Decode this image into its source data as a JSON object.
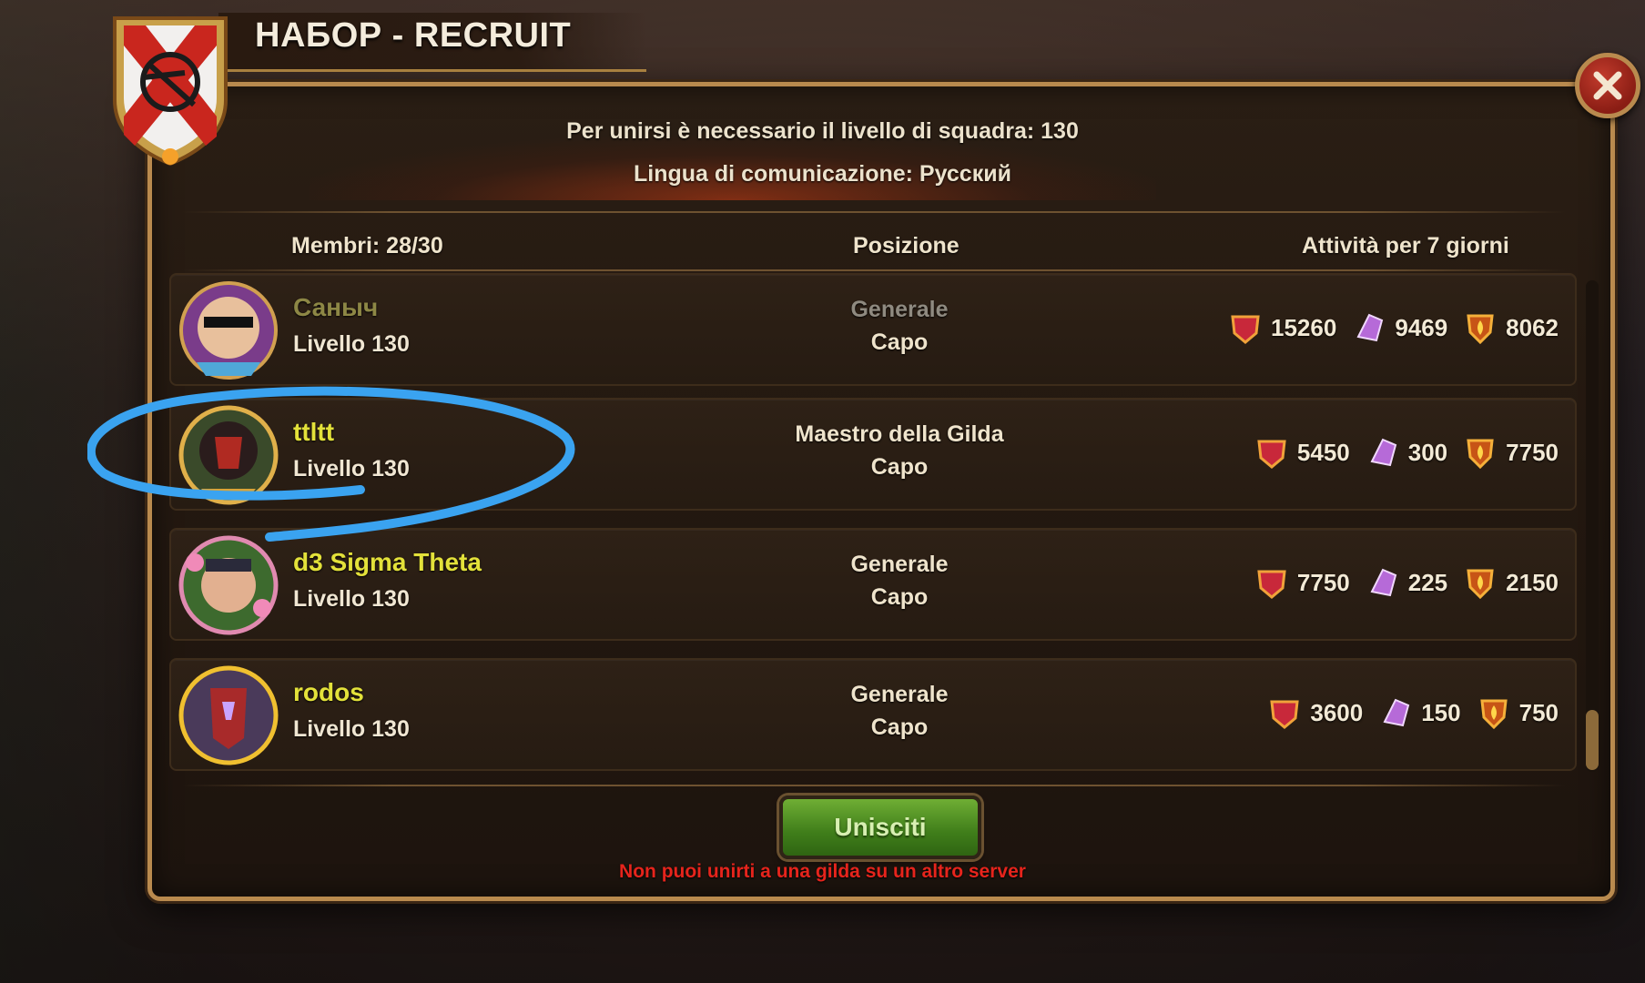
{
  "window": {
    "title": "НАБОР - RECRUIT",
    "close_icon": "close-x-icon"
  },
  "info": {
    "requirement": "Per unirsi è necessario il livello di squadra: 130",
    "language": "Lingua di comunicazione: Русский"
  },
  "columns": {
    "members": "Membri: 28/30",
    "position": "Posizione",
    "activity": "Attività per 7 giorni"
  },
  "members": [
    {
      "name": "Саныч",
      "level": "Livello 130",
      "role": "Generale",
      "rank": "Capo",
      "stat1": "15260",
      "stat2": "9469",
      "stat3": "8062",
      "name_color": "#8d8745",
      "role_color": "#8f8a80"
    },
    {
      "name": "ttltt",
      "level": "Livello 130",
      "role": "Maestro della Gilda",
      "rank": "Capo",
      "stat1": "5450",
      "stat2": "300",
      "stat3": "7750",
      "name_color": "#e3e13a",
      "role_color": "#efe4cc"
    },
    {
      "name": "d3 Sigma Theta",
      "level": "Livello 130",
      "role": "Generale",
      "rank": "Capo",
      "stat1": "7750",
      "stat2": "225",
      "stat3": "2150",
      "name_color": "#e3e13a",
      "role_color": "#efe4cc"
    },
    {
      "name": "rodos",
      "level": "Livello 130",
      "role": "Generale",
      "rank": "Capo",
      "stat1": "3600",
      "stat2": "150",
      "stat3": "750",
      "name_color": "#e3e13a",
      "role_color": "#efe4cc"
    }
  ],
  "icons": {
    "stat1": "red-guild-shield-icon",
    "stat2": "purple-titanite-crystal-icon",
    "stat3": "orange-flame-shield-icon"
  },
  "actions": {
    "join_label": "Unisciti",
    "warning": "Non puoi unirti a una gilda su un altro server"
  },
  "colors": {
    "frame": "#b98a4e",
    "join_button": "#4f9024",
    "warning": "#e6241c",
    "highlight": "#3aa3f0"
  }
}
